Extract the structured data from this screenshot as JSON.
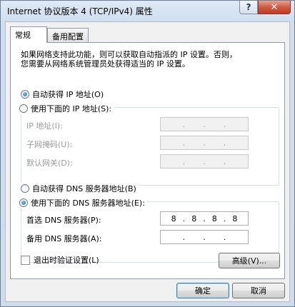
{
  "window": {
    "title": "Internet 协议版本 4 (TCP/IPv4) 属性",
    "help_label": "?",
    "close_label": "✕"
  },
  "tabs": [
    {
      "label": "常规",
      "active": true
    },
    {
      "label": "备用配置",
      "active": false
    }
  ],
  "general": {
    "description": "如果网络支持此功能，则可以获取自动指派的 IP 设置。否则，\n您需要从网络系统管理员处获得适当的 IP 设置。",
    "ip": {
      "auto_label": "自动获得 IP 地址(O)",
      "manual_label": "使用下面的 IP 地址(S):",
      "selected": "auto",
      "fields": [
        {
          "label": "IP 地址(I):",
          "octets": [
            "",
            "",
            "",
            ""
          ]
        },
        {
          "label": "子网掩码(U):",
          "octets": [
            "",
            "",
            "",
            ""
          ]
        },
        {
          "label": "默认网关(D):",
          "octets": [
            "",
            "",
            "",
            ""
          ]
        }
      ]
    },
    "dns": {
      "auto_label": "自动获得 DNS 服务器地址(B)",
      "manual_label": "使用下面的 DNS 服务器地址(E):",
      "selected": "manual",
      "preferred_label": "首选 DNS 服务器(P):",
      "preferred": [
        "8",
        "8",
        "8",
        "8"
      ],
      "alternate_label": "备用 DNS 服务器(A):",
      "alternate": [
        "",
        "",
        "",
        ""
      ]
    },
    "validate_label": "退出时验证设置(L)",
    "validate_checked": false,
    "advanced_label": "高级(V)..."
  },
  "footer": {
    "ok_label": "确定",
    "cancel_label": "取消"
  }
}
